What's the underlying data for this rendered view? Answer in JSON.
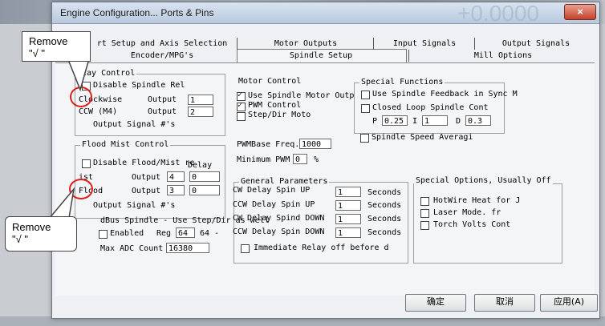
{
  "window": {
    "title": "Engine Configuration... Ports & Pins",
    "title_ghost": "+0.0000",
    "close_icon": "×"
  },
  "tabs": {
    "row1": [
      "rt Setup and Axis Selection",
      "Motor Outputs",
      "Input Signals",
      "Output Signals"
    ],
    "row2": [
      "Encoder/MPG's",
      "Spindle Setup",
      "Mill Options"
    ]
  },
  "relay": {
    "label": "lay Control",
    "disable": "Disable Spindle Rel",
    "clockwise": "Clockwise",
    "ccw": "CCW (M4)",
    "output": "Output",
    "cw_value": "1",
    "ccw_value": "2",
    "signal": "Output Signal #'s"
  },
  "flood": {
    "label": "Flood Mist Control",
    "disable": "Disable Flood/Mist re",
    "delay": "Delay",
    "mist": "ist",
    "flood": "Flood",
    "output": "Output",
    "mist_value": "4",
    "mist_delay": "0",
    "flood_value": "3",
    "flood_delay": "0",
    "signal": "Output Signal #'s"
  },
  "modbus": {
    "label": "dBus Spindle - Use Step/Dir as well",
    "enabled": "Enabled",
    "reg": "Reg",
    "reg_value": "64",
    "reg_tail": "64 -",
    "max_adc": "Max ADC Count",
    "max_adc_value": "16380"
  },
  "motor": {
    "label": "Motor Control",
    "use_spindle": "Use Spindle Motor Outp",
    "pwm": "PWM Control",
    "stepdir": "Step/Dir Moto",
    "pwmbase": "PWMBase Freq.",
    "pwmbase_value": "1000",
    "min_pwm": "Minimum PWM",
    "min_pwm_value": "0",
    "percent": "%"
  },
  "special": {
    "label": "Special Functions",
    "feedback": "Use Spindle Feedback in Sync M",
    "closed_loop": "Closed Loop Spindle Cont",
    "p": "P",
    "p_value": "0.25",
    "i": "I",
    "i_value": "1",
    "d": "D",
    "d_value": "0.3",
    "averaging": "Spindle Speed Averagi"
  },
  "general": {
    "label": "General Parameters",
    "rows": [
      {
        "label": "CW Delay Spin UP",
        "value": "1",
        "unit": "Seconds"
      },
      {
        "label": "CCW Delay Spin UP",
        "value": "1",
        "unit": "Seconds"
      },
      {
        "label": "CW Delay Spind DOWN",
        "value": "1",
        "unit": "Seconds"
      },
      {
        "label": "CCW Delay Spin DOWN",
        "value": "1",
        "unit": "Seconds"
      }
    ],
    "immediate": "Immediate Relay off before d"
  },
  "options": {
    "label": "Special Options, Usually Off",
    "hotwire": "HotWire Heat for J",
    "laser": "Laser Mode. fr",
    "torch": "Torch Volts Cont"
  },
  "buttons": {
    "ok": "确定",
    "cancel": "取消",
    "apply": "应用(A)"
  },
  "annotations": {
    "remove_top": "Remove\n\"√ \"",
    "remove_bottom": "Remove\n\"√ \""
  },
  "colors": {
    "highlight_circle": "#e0201b"
  }
}
